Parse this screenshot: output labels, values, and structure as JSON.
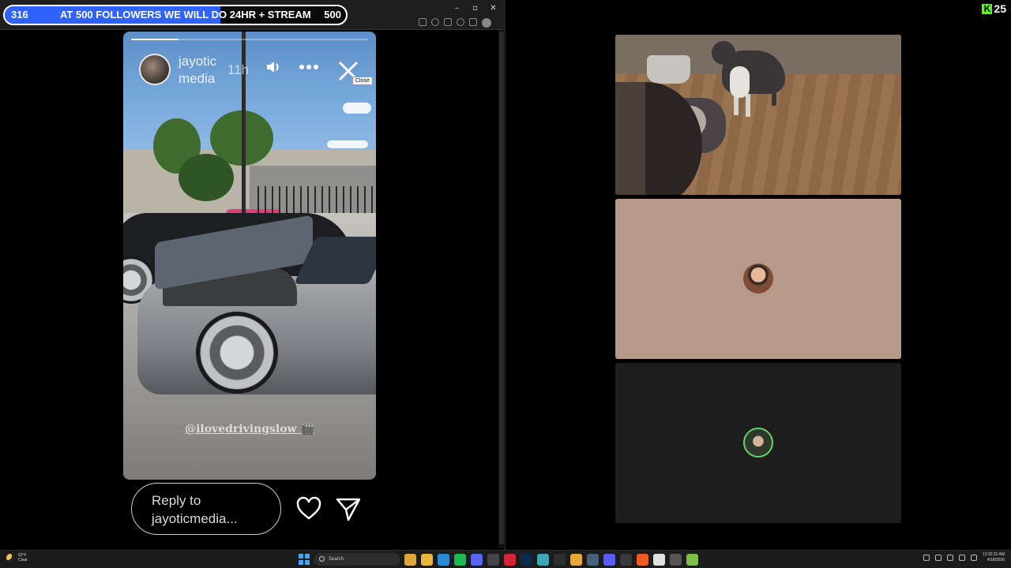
{
  "goal": {
    "current": "316",
    "label": "AT 500 FOLLOWERS WE WILL DO 24HR + STREAM",
    "target": "500",
    "progress_fraction": 0.632,
    "fill_color": "#2f63ff"
  },
  "window_controls": {
    "minimize": "–",
    "maximize": "▫",
    "close": "✕"
  },
  "story": {
    "username_line1": "jayotic",
    "username_line2": "media",
    "time": "11h",
    "tag": "@ilovedrivingslow 🎬",
    "close_tooltip": "Close",
    "progress_fraction": 0.2,
    "icons": {
      "sound": "speaker-icon",
      "more": "more-icon",
      "close": "close-icon"
    }
  },
  "reply": {
    "placeholder_line1": "Reply to",
    "placeholder_line2": "jayoticmedia..."
  },
  "kick": {
    "logo": "K",
    "viewers": "25",
    "color": "#53fc18"
  },
  "taskbar": {
    "weather_temp": "52°F",
    "weather_cond": "Clear",
    "search_placeholder": "Search",
    "time": "12:32:21 AM",
    "date": "4/18/2026",
    "apps": [
      {
        "name": "chrome-icon",
        "color": "#e0a63b"
      },
      {
        "name": "file-explorer-icon",
        "color": "#e8b83e"
      },
      {
        "name": "edge-icon",
        "color": "#2a8bd6"
      },
      {
        "name": "spotify-icon",
        "color": "#1db954"
      },
      {
        "name": "discord-icon",
        "color": "#5865f2"
      },
      {
        "name": "obs-icon",
        "color": "#444444"
      },
      {
        "name": "adobe-icon",
        "color": "#d4233b"
      },
      {
        "name": "photoshop-icon",
        "color": "#0a2b4a"
      },
      {
        "name": "app-icon",
        "color": "#3fa6b6"
      },
      {
        "name": "terminal-icon",
        "color": "#2e2e2e"
      },
      {
        "name": "app-icon",
        "color": "#e7a83a"
      },
      {
        "name": "app-icon",
        "color": "#46627a"
      },
      {
        "name": "app-icon",
        "color": "#595ef0"
      },
      {
        "name": "headset-icon",
        "color": "#3a3a3a"
      },
      {
        "name": "brave-icon",
        "color": "#ef5b25"
      },
      {
        "name": "app-icon",
        "color": "#e0e0e0"
      },
      {
        "name": "app-icon",
        "color": "#555555"
      },
      {
        "name": "app-icon",
        "color": "#7cbf46"
      }
    ]
  }
}
